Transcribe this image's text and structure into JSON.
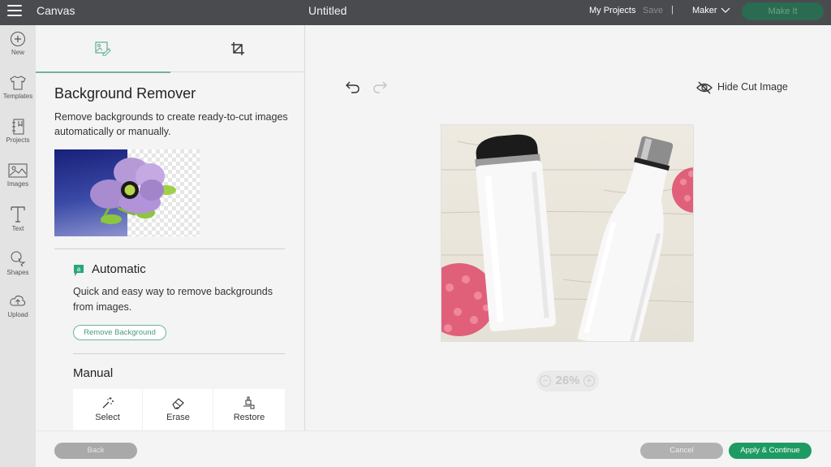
{
  "topbar": {
    "app_title": "Canvas",
    "doc_title": "Untitled",
    "my_projects": "My Projects",
    "save": "Save",
    "separator": "|",
    "machine": "Maker",
    "make_it": "Make It"
  },
  "rail": {
    "items": [
      {
        "label": "New",
        "icon": "plus-circle-icon"
      },
      {
        "label": "Templates",
        "icon": "tshirt-icon"
      },
      {
        "label": "Projects",
        "icon": "notebook-icon"
      },
      {
        "label": "Images",
        "icon": "image-icon"
      },
      {
        "label": "Text",
        "icon": "text-icon"
      },
      {
        "label": "Shapes",
        "icon": "shapes-icon"
      },
      {
        "label": "Upload",
        "icon": "cloud-upload-icon"
      }
    ]
  },
  "panel": {
    "tabs": [
      {
        "name": "background-remover",
        "icon": "image-edit-icon",
        "active": true
      },
      {
        "name": "crop",
        "icon": "crop-icon",
        "active": false
      }
    ],
    "title": "Background Remover",
    "description": "Remove backgrounds to create ready-to-cut images automatically or manually.",
    "automatic": {
      "title": "Automatic",
      "description": "Quick and easy way to remove backgrounds from images.",
      "button": "Remove Background"
    },
    "manual": {
      "title": "Manual",
      "tools": [
        {
          "label": "Select",
          "icon": "magic-wand-icon"
        },
        {
          "label": "Erase",
          "icon": "eraser-icon"
        },
        {
          "label": "Restore",
          "icon": "brush-restore-icon"
        }
      ]
    }
  },
  "canvas": {
    "hide_cut_image": "Hide Cut Image",
    "zoom_level": "26%",
    "zoom_minus": "−",
    "zoom_plus": "+"
  },
  "bottombar": {
    "back": "Back",
    "cancel": "Cancel",
    "apply": "Apply & Continue"
  },
  "colors": {
    "accent": "#1e9b62",
    "accent_light": "#6cb597",
    "topbar": "#4a4b4f"
  }
}
